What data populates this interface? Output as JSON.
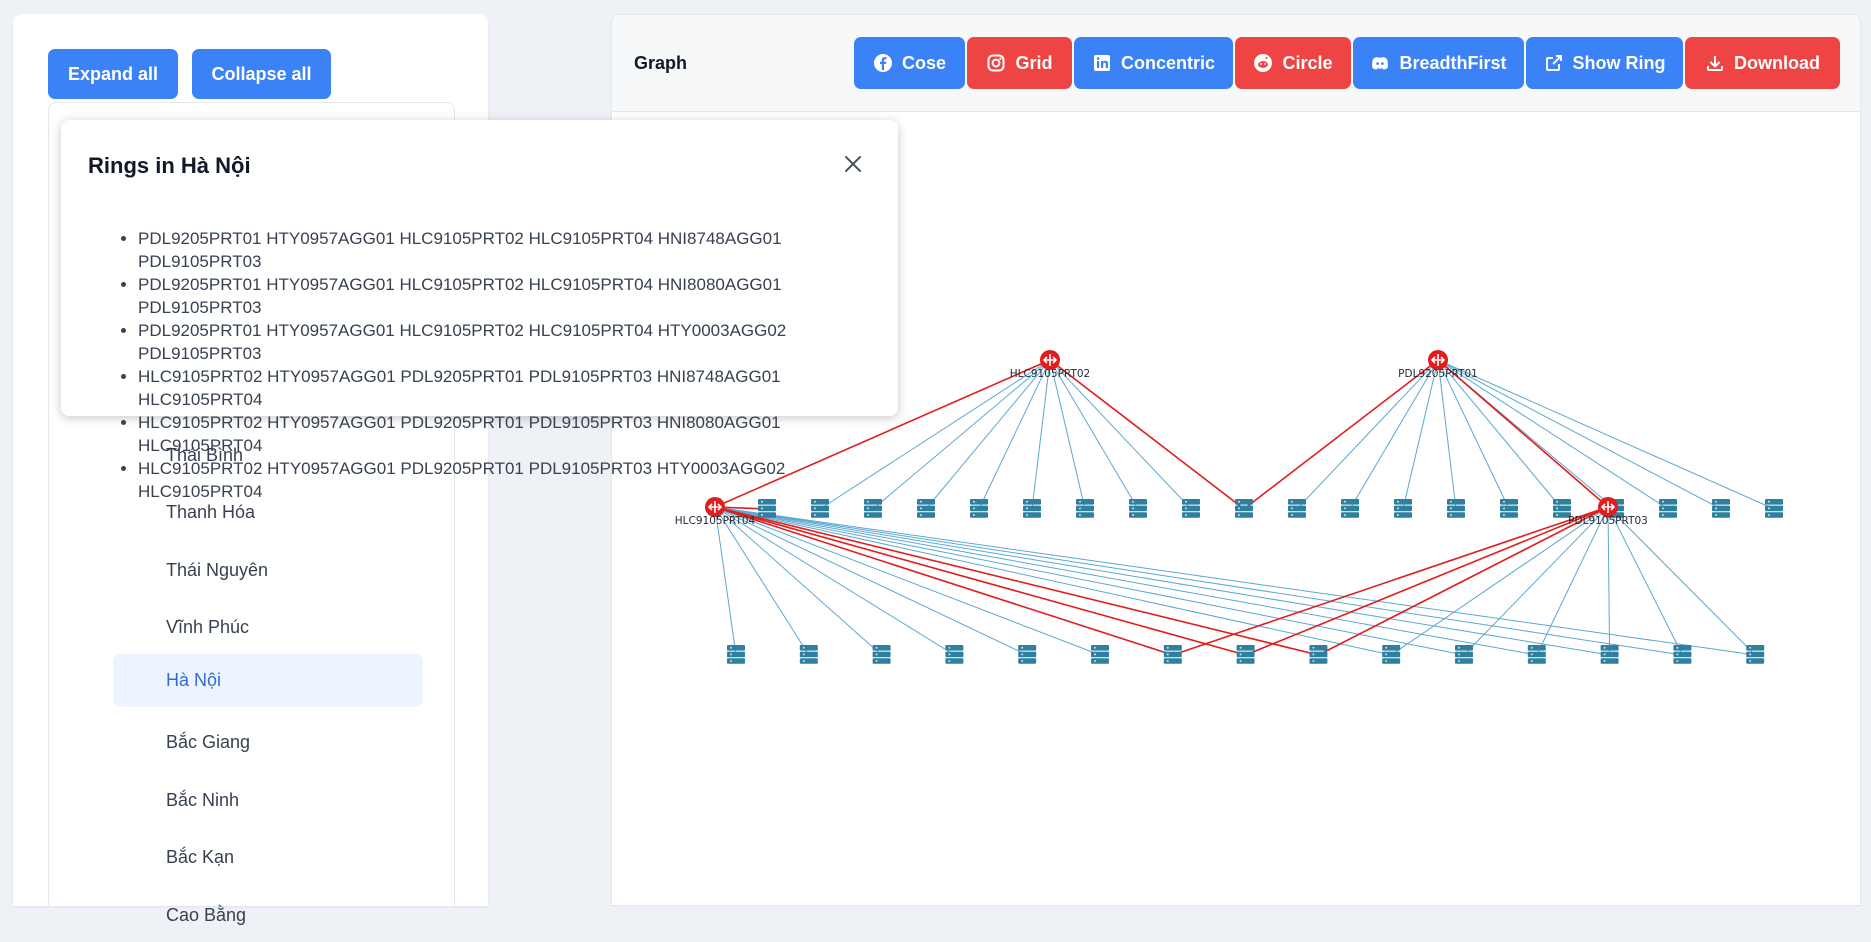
{
  "sidebar": {
    "expand_label": "Expand all",
    "collapse_label": "Collapse all",
    "items": [
      "Thái Bình",
      "Thanh Hóa",
      "Thái Nguyên",
      "Vĩnh Phúc",
      "Hà Nội",
      "Bắc Giang",
      "Bắc Ninh",
      "Bắc Kạn",
      "Cao Bằng"
    ],
    "selected": "Hà Nội"
  },
  "graph": {
    "title": "Graph",
    "buttons": [
      {
        "label": "Cose",
        "icon": "facebook-icon",
        "color": "#3b82f6"
      },
      {
        "label": "Grid",
        "icon": "instagram-icon",
        "color": "#ef4444"
      },
      {
        "label": "Concentric",
        "icon": "linkedin-icon",
        "color": "#3b82f6"
      },
      {
        "label": "Circle",
        "icon": "reddit-icon",
        "color": "#ef4444"
      },
      {
        "label": "BreadthFirst",
        "icon": "discord-icon",
        "color": "#3b82f6"
      },
      {
        "label": "Show Ring",
        "icon": "external-link-icon",
        "color": "#3b82f6"
      },
      {
        "label": "Download",
        "icon": "download-icon",
        "color": "#ef4444"
      }
    ],
    "routers": [
      "HLC9105PRT02",
      "PDL9205PRT01",
      "HLC9105PRT04",
      "PDL9105PRT03"
    ],
    "colors": {
      "ring_edge": "#e11d1d",
      "edge": "#5aa8d0",
      "router": "#e11d1d",
      "server": "#2f7f9e"
    }
  },
  "modal": {
    "title": "Rings in Hà Nội",
    "rings": [
      "PDL9205PRT01 HTY0957AGG01 HLC9105PRT02 HLC9105PRT04 HNI8748AGG01 PDL9105PRT03",
      "PDL9205PRT01 HTY0957AGG01 HLC9105PRT02 HLC9105PRT04 HNI8080AGG01 PDL9105PRT03",
      "PDL9205PRT01 HTY0957AGG01 HLC9105PRT02 HLC9105PRT04 HTY0003AGG02 PDL9105PRT03",
      "HLC9105PRT02 HTY0957AGG01 PDL9205PRT01 PDL9105PRT03 HNI8748AGG01 HLC9105PRT04",
      "HLC9105PRT02 HTY0957AGG01 PDL9205PRT01 PDL9105PRT03 HNI8080AGG01 HLC9105PRT04",
      "HLC9105PRT02 HTY0957AGG01 PDL9205PRT01 PDL9105PRT03 HTY0003AGG02 HLC9105PRT04"
    ]
  }
}
